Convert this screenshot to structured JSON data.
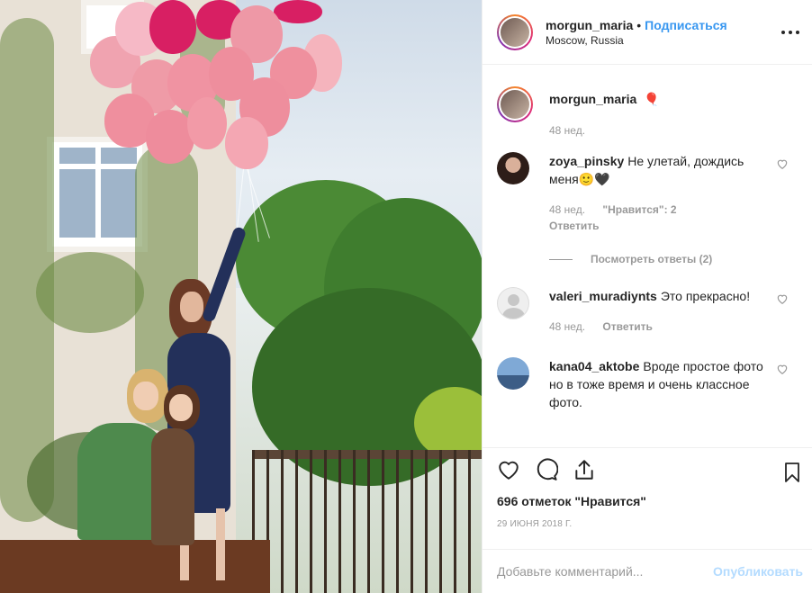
{
  "post": {
    "username": "morgun_maria",
    "follow_label": "Подписаться",
    "separator": "•",
    "location": "Moscow, Russia",
    "caption_emoji": "🎈",
    "caption_time": "48 нед."
  },
  "comments": [
    {
      "user": "zoya_pinsky",
      "text": "Не улетай, дождись меня🙂🖤",
      "time": "48 нед.",
      "likes": "\"Нравится\": 2",
      "reply": "Ответить",
      "view_replies": "Посмотреть ответы (2)"
    },
    {
      "user": "valeri_muradiynts",
      "text": "Это прекрасно!",
      "time": "48 нед.",
      "reply": "Ответить"
    },
    {
      "user": "kana04_aktobe",
      "text": "Вроде простое фото но в тоже время и очень классное фото."
    }
  ],
  "footer": {
    "likes_text": "696 отметок \"Нравится\"",
    "date": "29 ИЮНЯ 2018 Г.",
    "comment_placeholder": "Добавьте комментарий...",
    "publish_label": "Опубликовать"
  },
  "colors": {
    "accent": "#3897f0",
    "muted": "#999999",
    "publish_disabled": "#b3dbff"
  }
}
